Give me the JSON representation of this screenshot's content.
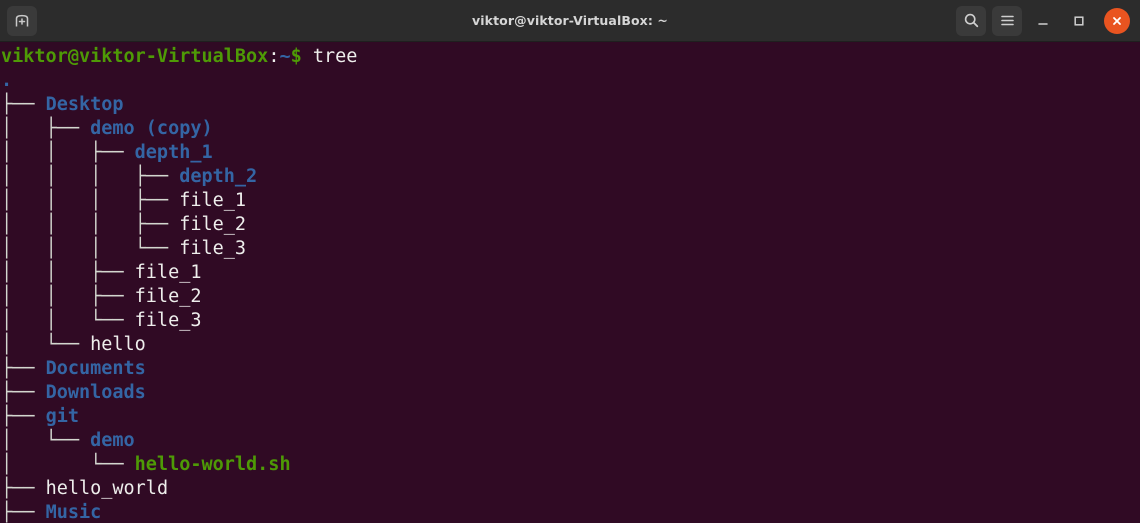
{
  "window": {
    "title": "viktor@viktor-VirtualBox: ~",
    "colors": {
      "background": "#300a24",
      "titlebar": "#2c2c2c",
      "directory": "#3465a4",
      "executable": "#4e9a06",
      "file": "#eeeeec",
      "prompt_green": "#4e9a06",
      "close_button": "#e95420"
    }
  },
  "titlebar": {
    "new_tab_icon": "new-tab-icon",
    "search_icon": "search-icon",
    "menu_icon": "hamburger-menu-icon",
    "minimize_icon": "minimize-icon",
    "maximize_icon": "maximize-icon",
    "close_icon": "close-icon"
  },
  "terminal": {
    "prompt": {
      "user_host": "viktor@viktor-VirtualBox",
      "colon": ":",
      "path": "~",
      "sigil": "$",
      "command": "tree"
    },
    "lines": [
      {
        "connector": "",
        "name": ".",
        "type": "dir"
      },
      {
        "connector": "├── ",
        "name": "Desktop",
        "type": "dir"
      },
      {
        "connector": "│   ├── ",
        "name": "demo (copy)",
        "type": "dir"
      },
      {
        "connector": "│   │   ├── ",
        "name": "depth_1",
        "type": "dir"
      },
      {
        "connector": "│   │   │   ├── ",
        "name": "depth_2",
        "type": "dir"
      },
      {
        "connector": "│   │   │   ├── ",
        "name": "file_1",
        "type": "file"
      },
      {
        "connector": "│   │   │   ├── ",
        "name": "file_2",
        "type": "file"
      },
      {
        "connector": "│   │   │   └── ",
        "name": "file_3",
        "type": "file"
      },
      {
        "connector": "│   │   ├── ",
        "name": "file_1",
        "type": "file"
      },
      {
        "connector": "│   │   ├── ",
        "name": "file_2",
        "type": "file"
      },
      {
        "connector": "│   │   └── ",
        "name": "file_3",
        "type": "file"
      },
      {
        "connector": "│   └── ",
        "name": "hello",
        "type": "file"
      },
      {
        "connector": "├── ",
        "name": "Documents",
        "type": "dir"
      },
      {
        "connector": "├── ",
        "name": "Downloads",
        "type": "dir"
      },
      {
        "connector": "├── ",
        "name": "git",
        "type": "dir"
      },
      {
        "connector": "│   └── ",
        "name": "demo",
        "type": "dir"
      },
      {
        "connector": "│       └── ",
        "name": "hello-world.sh",
        "type": "exec"
      },
      {
        "connector": "├── ",
        "name": "hello_world",
        "type": "file"
      },
      {
        "connector": "├── ",
        "name": "Music",
        "type": "dir"
      }
    ]
  }
}
